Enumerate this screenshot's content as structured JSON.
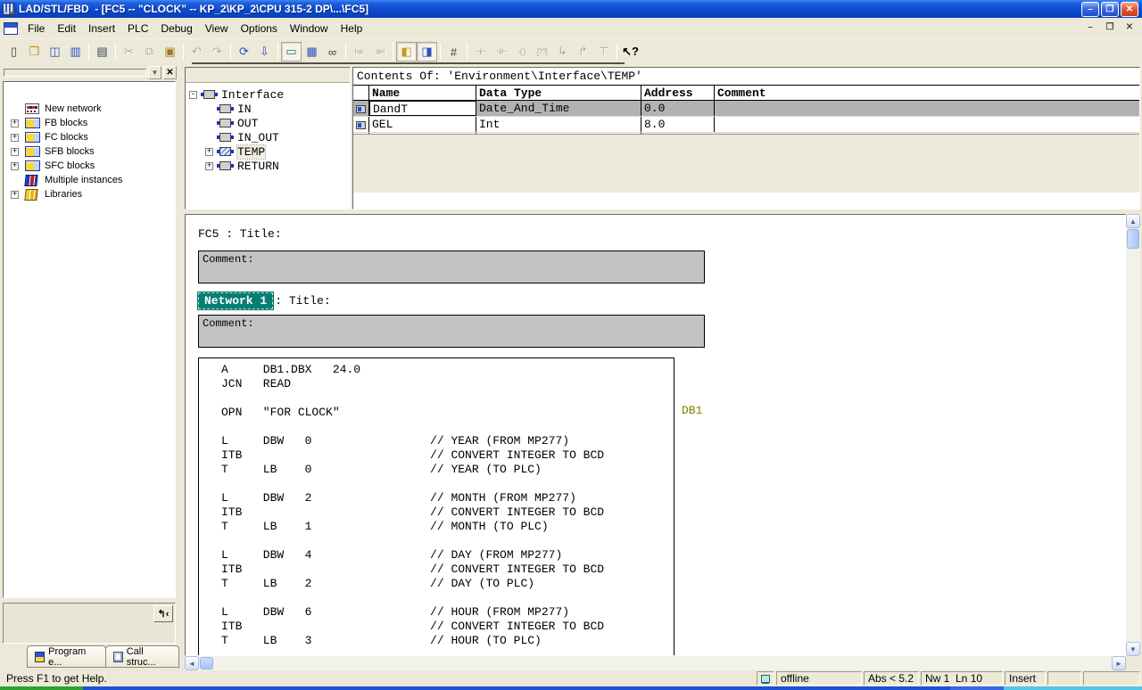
{
  "window": {
    "title": "LAD/STL/FBD  - [FC5 -- \"CLOCK\" -- KP_2\\KP_2\\CPU 315-2 DP\\...\\FC5]",
    "controls": {
      "minimize": "–",
      "restore": "❐",
      "close": "✕"
    }
  },
  "menu_bar": {
    "items": [
      "File",
      "Edit",
      "Insert",
      "PLC",
      "Debug",
      "View",
      "Options",
      "Window",
      "Help"
    ]
  },
  "toolbar": {
    "buttons": [
      {
        "name": "new",
        "glyph": "▯"
      },
      {
        "name": "open",
        "glyph": "❒"
      },
      {
        "name": "open-station",
        "glyph": "◫"
      },
      {
        "name": "save",
        "glyph": "▥"
      },
      {
        "name": "print",
        "glyph": "▤"
      },
      {
        "name": "cut",
        "glyph": "✂"
      },
      {
        "name": "copy",
        "glyph": "⧉"
      },
      {
        "name": "paste",
        "glyph": "▣"
      },
      {
        "name": "undo",
        "glyph": "↶"
      },
      {
        "name": "redo",
        "glyph": "↷"
      },
      {
        "name": "update",
        "glyph": "⟳"
      },
      {
        "name": "download",
        "glyph": "⇩"
      },
      {
        "name": "symbol-toggle",
        "glyph": "▭"
      },
      {
        "name": "symbol-info",
        "glyph": "▦"
      },
      {
        "name": "monitor-glasses",
        "glyph": "∞"
      },
      {
        "name": "prev-error",
        "glyph": "!≪"
      },
      {
        "name": "next-error",
        "glyph": "≫!"
      },
      {
        "name": "overview",
        "glyph": "◧"
      },
      {
        "name": "detail-view",
        "glyph": "◨"
      },
      {
        "name": "new-network",
        "glyph": "#"
      },
      {
        "name": "normally-open-contact",
        "glyph": "⊣⊢"
      },
      {
        "name": "normally-closed-contact",
        "glyph": "⊣/⊢"
      },
      {
        "name": "coil",
        "glyph": "-( )"
      },
      {
        "name": "empty-box",
        "glyph": "[??]"
      },
      {
        "name": "open-branch",
        "glyph": "↳"
      },
      {
        "name": "close-branch",
        "glyph": "↱"
      },
      {
        "name": "t-branch",
        "glyph": "⊤"
      },
      {
        "name": "help-select",
        "glyph": "↖?"
      }
    ]
  },
  "sidebar": {
    "toolbar": {
      "dropdown_glyph": "▼",
      "close_glyph": "✕"
    },
    "tree": [
      {
        "label": "New network"
      },
      {
        "label": "FB blocks",
        "expand": "+"
      },
      {
        "label": "FC blocks",
        "expand": "+"
      },
      {
        "label": "SFB blocks",
        "expand": "+"
      },
      {
        "label": "SFC blocks",
        "expand": "+"
      },
      {
        "label": "Multiple instances"
      },
      {
        "label": "Libraries",
        "expand": "+"
      }
    ],
    "goto_button_glyph": "↰‹",
    "tabs": [
      {
        "label": "Program e..."
      },
      {
        "label": "Call struc..."
      }
    ]
  },
  "interface_pane": {
    "root": {
      "label": "Interface",
      "expand": "-"
    },
    "items": [
      {
        "label": "IN"
      },
      {
        "label": "OUT"
      },
      {
        "label": "IN_OUT"
      },
      {
        "label": "TEMP",
        "expand": "+"
      },
      {
        "label": "RETURN",
        "expand": "+"
      }
    ]
  },
  "contents_pane": {
    "title": "Contents Of: 'Environment\\Interface\\TEMP'",
    "columns": [
      "Name",
      "Data Type",
      "Address",
      "Comment"
    ],
    "rows": [
      {
        "name": "DandT",
        "type": "Date_And_Time",
        "address": "0.0",
        "comment": ""
      },
      {
        "name": "GEL",
        "type": "Int",
        "address": "8.0",
        "comment": ""
      }
    ]
  },
  "code_pane": {
    "block_title": "FC5 : Title:",
    "comment1": "Comment:",
    "network_badge": "Network 1",
    "network_title": ": Title:",
    "comment2": "Comment:",
    "db_ref": "DB1",
    "lines": [
      "A     DB1.DBX   24.0",
      "JCN   READ",
      "",
      "OPN   \"FOR CLOCK\"",
      "",
      "L     DBW   0                 // YEAR (FROM MP277)",
      "ITB                           // CONVERT INTEGER TO BCD",
      "T     LB    0                 // YEAR (TO PLC)",
      "",
      "L     DBW   2                 // MONTH (FROM MP277)",
      "ITB                           // CONVERT INTEGER TO BCD",
      "T     LB    1                 // MONTH (TO PLC)",
      "",
      "L     DBW   4                 // DAY (FROM MP277)",
      "ITB                           // CONVERT INTEGER TO BCD",
      "T     LB    2                 // DAY (TO PLC)",
      "",
      "L     DBW   6                 // HOUR (FROM MP277)",
      "ITB                           // CONVERT INTEGER TO BCD",
      "T     LB    3                 // HOUR (TO PLC)"
    ]
  },
  "status_bar": {
    "help": "Press F1 to get Help.",
    "connection": "offline",
    "abs": "Abs < 5.2",
    "position": "Nw 1  Ln 10",
    "mode": "Insert"
  },
  "glyphs": {
    "up": "▲",
    "down": "▼",
    "left": "◄",
    "right": "►"
  },
  "colors": {
    "network_badge": "#077e74",
    "db_ref": "#808000",
    "selected_row": "#b2b2b2",
    "titlebar": "#0d4ad1"
  }
}
